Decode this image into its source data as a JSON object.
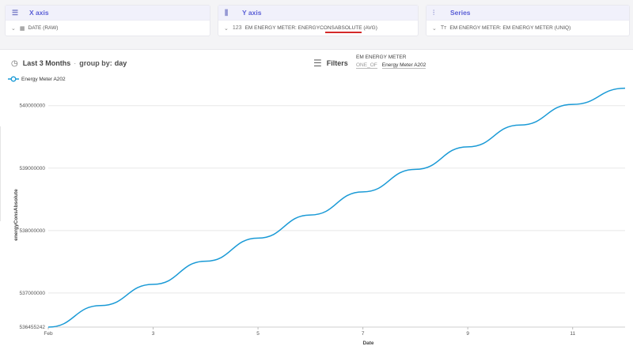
{
  "config": {
    "x_axis": {
      "title": "X axis",
      "icon": "list-icon",
      "value": "DATE (RAW)"
    },
    "y_axis": {
      "title": "Y axis",
      "icon": "bars-icon",
      "type_glyph": "123",
      "value": "EM ENERGY METER: ENERGYCONSABSOLUTE (AVG)"
    },
    "series": {
      "title": "Series",
      "icon": "chart-icon",
      "type_glyph": "Tт",
      "value": "EM ENERGY METER: EM ENERGY METER (UNIQ)"
    }
  },
  "controls": {
    "range": "Last 3 Months",
    "group_prefix": "group by:",
    "group_value": "day",
    "filters_label": "Filters",
    "filter_field": "EM ENERGY METER",
    "filter_op": "ONE_OF",
    "filter_value": "Energy Meter A202"
  },
  "colors": {
    "accent": "#5b5fd6",
    "line": "#1a9ad6",
    "highlight": "#d42a2a"
  },
  "chart_data": {
    "type": "line",
    "xlabel": "Date",
    "ylabel": "energyConsAbsolute",
    "x": [
      1,
      2,
      3,
      4,
      5,
      6,
      7,
      8,
      9,
      10,
      11,
      12
    ],
    "x_ticks": [
      1,
      3,
      5,
      7,
      9,
      11
    ],
    "x_tick_labels": [
      "Feb",
      "3",
      "5",
      "7",
      "9",
      "11"
    ],
    "xlim": [
      1,
      12
    ],
    "y_ticks": [
      536455242,
      537000000,
      538000000,
      539000000,
      540000000
    ],
    "y_tick_labels": [
      "536455242",
      "537000000",
      "538000000",
      "539000000",
      "540000000"
    ],
    "ylim": [
      536455242,
      540300000
    ],
    "grid": true,
    "series": [
      {
        "name": "Energy Meter A202",
        "values": [
          536455242,
          536800000,
          537140000,
          537510000,
          537880000,
          538250000,
          538620000,
          538980000,
          539340000,
          539690000,
          540020000,
          540280000
        ]
      }
    ],
    "legend_position": "top-left"
  }
}
